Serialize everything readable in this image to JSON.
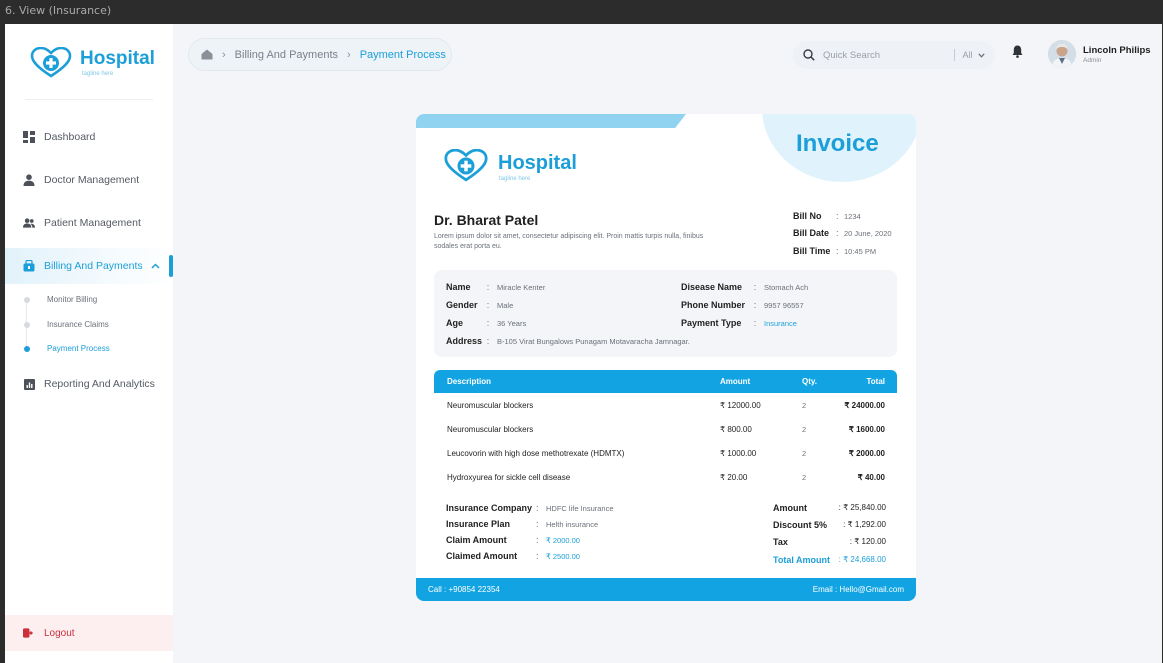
{
  "window_title": "6. View (Insurance)",
  "brand": {
    "name": "Hospital",
    "tagline": "tagline here"
  },
  "sidebar": {
    "items": [
      {
        "label": "Dashboard",
        "icon": "dashboard-icon"
      },
      {
        "label": "Doctor Management",
        "icon": "doctor-icon"
      },
      {
        "label": "Patient Management",
        "icon": "patients-icon"
      },
      {
        "label": "Billing And Payments",
        "icon": "billing-icon",
        "expanded": true
      },
      {
        "label": "Reporting And Analytics",
        "icon": "reports-icon"
      }
    ],
    "sub_items": [
      {
        "label": "Monitor Billing"
      },
      {
        "label": "Insurance Claims"
      },
      {
        "label": "Payment Process",
        "active": true
      }
    ],
    "logout_label": "Logout"
  },
  "breadcrumb": {
    "items": [
      "Billing And Payments",
      "Payment Process"
    ]
  },
  "search": {
    "placeholder": "Quick Search",
    "filter": "All"
  },
  "user": {
    "name": "Lincoln Philips",
    "role": "Admin"
  },
  "invoice": {
    "title": "Invoice",
    "doctor": "Dr. Bharat Patel",
    "description": "Lorem ipsum dolor sit amet, consectetur adipiscing elit. Proin mattis turpis nulla, finibus sodales erat porta eu.",
    "bill": {
      "no_label": "Bill No",
      "no": "1234",
      "date_label": "Bill Date",
      "date": "20 June, 2020",
      "time_label": "Bill Time",
      "time": "10:45 PM"
    },
    "patient": {
      "name_label": "Name",
      "name": "Miracle Kenter",
      "gender_label": "Gender",
      "gender": "Male",
      "age_label": "Age",
      "age": "36 Years",
      "address_label": "Address",
      "address": "B-105 Virat Bungalows Punagam Motavaracha Jamnagar.",
      "disease_label": "Disease Name",
      "disease": "Stomach Ach",
      "phone_label": "Phone Number",
      "phone": "9957 96557",
      "payment_label": "Payment Type",
      "payment": "Insurance"
    },
    "table": {
      "headers": {
        "description": "Description",
        "amount": "Amount",
        "qty": "Qty.",
        "total": "Total"
      },
      "rows": [
        {
          "description": "Neuromuscular blockers",
          "amount": "₹ 12000.00",
          "qty": "2",
          "total": "₹ 24000.00"
        },
        {
          "description": "Neuromuscular blockers",
          "amount": "₹ 800.00",
          "qty": "2",
          "total": "₹ 1600.00"
        },
        {
          "description": "Leucovorin with high dose methotrexate (HDMTX)",
          "amount": "₹ 1000.00",
          "qty": "2",
          "total": "₹ 2000.00"
        },
        {
          "description": "Hydroxyurea for sickle cell disease",
          "amount": "₹ 20.00",
          "qty": "2",
          "total": "₹ 40.00"
        }
      ]
    },
    "insurance": {
      "company_label": "Insurance Company",
      "company": "HDFC life Insurance",
      "plan_label": "Insurance Plan",
      "plan": "Helth insurance",
      "claim_label": "Claim Amount",
      "claim": "₹ 2000.00",
      "claimed_label": "Claimed Amount",
      "claimed": "₹ 2500.00"
    },
    "summary": {
      "amount_label": "Amount",
      "amount": ": ₹ 25,840.00",
      "discount_label": "Discount 5%",
      "discount": ": ₹ 1,292.00",
      "tax_label": "Tax",
      "tax": ": ₹ 120.00",
      "total_label": "Total Amount",
      "total": ": ₹ 24,668.00"
    },
    "footer": {
      "call": "Call : +90854 22354",
      "email": "Email : Hello@Gmail.com"
    }
  },
  "colors": {
    "accent": "#1c9fd8",
    "header_blue": "#12a4e2",
    "logout_red": "#c9303b"
  }
}
